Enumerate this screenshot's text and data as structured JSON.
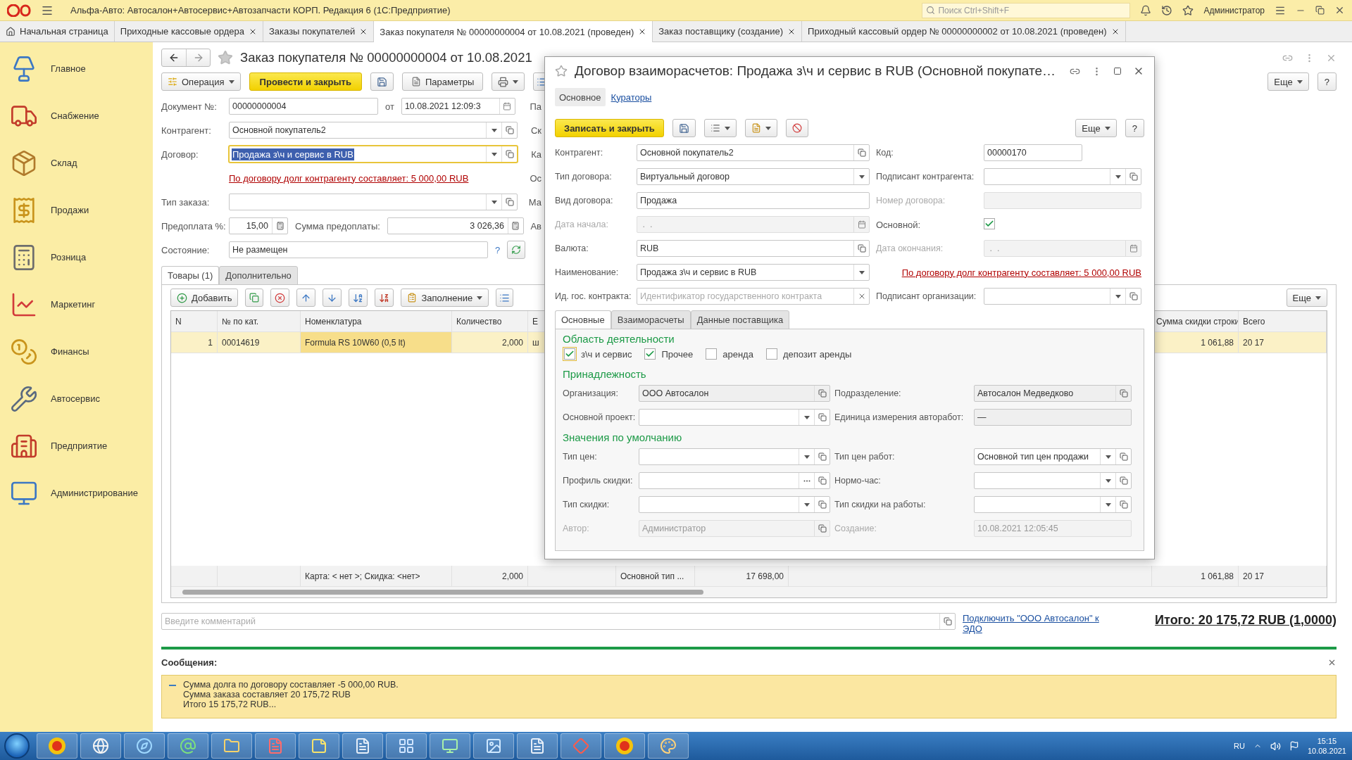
{
  "app_bar": {
    "title": "Альфа-Авто: Автосалон+Автосервис+Автозапчасти КОРП. Редакция 6  (1С:Предприятие)",
    "search_placeholder": "Поиск Ctrl+Shift+F",
    "user": "Администратор"
  },
  "tabs": [
    {
      "label": "Начальная страница",
      "selected": false,
      "kind": "home"
    },
    {
      "label": "Приходные кассовые ордера",
      "selected": false,
      "kind": "closable"
    },
    {
      "label": "Заказы покупателей",
      "selected": false,
      "kind": "closable"
    },
    {
      "label": "Заказ покупателя № 00000000004 от 10.08.2021 (проведен)",
      "selected": true,
      "kind": "closable"
    },
    {
      "label": "Заказ поставщику (создание)",
      "selected": false,
      "kind": "closable"
    },
    {
      "label": "Приходный кассовый ордер № 00000000002 от 10.08.2021 (проведен)",
      "selected": false,
      "kind": "closable"
    }
  ],
  "sidebar": {
    "items": [
      {
        "label": "Главное"
      },
      {
        "label": "Снабжение"
      },
      {
        "label": "Склад"
      },
      {
        "label": "Продажи"
      },
      {
        "label": "Розница"
      },
      {
        "label": "Маркетинг"
      },
      {
        "label": "Финансы"
      },
      {
        "label": "Автосервис"
      },
      {
        "label": "Предприятие"
      },
      {
        "label": "Администрирование"
      }
    ]
  },
  "document": {
    "title": "Заказ покупателя № 00000000004 от 10.08.2021",
    "toolbar": [
      {
        "kind": "menu",
        "label": "Операция"
      },
      {
        "kind": "primary",
        "label": "Провести и закрыть"
      },
      {
        "kind": "save"
      },
      {
        "kind": "doc",
        "label": "Параметры"
      },
      {
        "kind": "print"
      },
      {
        "kind": "list"
      }
    ],
    "more": "Еще",
    "help": "?",
    "number": {
      "label": "Документ №:",
      "value": "00000000004"
    },
    "date": {
      "label": "от",
      "value": "10.08.2021 12:09:3"
    },
    "counterparty": {
      "label": "Контрагент:",
      "value": "Основной покупатель2"
    },
    "contract": {
      "label": "Договор:",
      "value": "Продажа з\\ч и сервис в RUB",
      "focused": true
    },
    "debt_link": "По договору долг контрагенту составляет: 5 000,00 RUB",
    "order_type": {
      "label": "Тип заказа:"
    },
    "prepayment_percent": {
      "label": "Предоплата %:",
      "value": "15,00"
    },
    "prepayment_sum": {
      "label": "Сумма предоплаты:",
      "value": "3 026,36"
    },
    "status": {
      "label": "Состояние:",
      "value": "Не размещен",
      "help": "?"
    },
    "cut_labels": [
      "Па",
      "Ск",
      "Ка",
      "Ос",
      "Ма",
      "Ав"
    ],
    "subtabs": [
      {
        "label": "Товары (1)",
        "selected": true
      },
      {
        "label": "Дополнительно",
        "selected": false
      }
    ],
    "table_toolbar": [
      {
        "kind": "add",
        "label": "Добавить"
      },
      {
        "kind": "copy"
      },
      {
        "kind": "delete"
      },
      {
        "kind": "up"
      },
      {
        "kind": "down"
      },
      {
        "kind": "sort_asc"
      },
      {
        "kind": "sort_desc"
      },
      {
        "kind": "fill",
        "label": "Заполнение"
      },
      {
        "kind": "list"
      }
    ],
    "table_more": "Еще",
    "table": {
      "columns": {
        "column_1": "N",
        "column_2": "№ по кат.",
        "column_3": "Номенклатура",
        "column_4": "Количество",
        "column_5": "Е",
        "column_9": "Сумма скидки строки",
        "column_10": "Всего"
      },
      "rows": [
        {
          "column_1": {
            "text": "1",
            "selected": false
          },
          "column_2": {
            "text": "00014619",
            "selected": false
          },
          "column_3": {
            "text": "Formula RS 10W60 (0,5 lt)",
            "selected": true
          },
          "column_4": {
            "text": "2,000",
            "selected": false
          },
          "column_5": {
            "text": "ш",
            "selected": false
          },
          "column_9": {
            "text": "1 061,88",
            "selected": false
          },
          "column_10": {
            "text": "20 17",
            "selected": false
          }
        }
      ],
      "footer": {
        "column_3": "Карта: < нет >; Скидка: <нет>",
        "column_4": "2,000",
        "column_6": "Основной тип ...",
        "column_7": "17 698,00",
        "column_9": "1 061,88",
        "column_10": "20 17"
      }
    },
    "comment_placeholder": "Введите комментарий",
    "edo_link": "Подключить \"ООО Автосалон\" к ЭДО",
    "total": "Итого: 20 175,72 RUB (1,0000)"
  },
  "messages": {
    "title": "Сообщения:",
    "text": "Сумма долга по договору составляет -5 000,00 RUB.\nСумма заказа составляет 20 175,72 RUB\nИтого 15 175,72 RUB..."
  },
  "dialog": {
    "title": "Договор взаиморасчетов: Продажа з\\ч и сервис в RUB (Основной покупате…",
    "tabs": [
      {
        "label": "Основное",
        "selected": true
      },
      {
        "label": "Кураторы",
        "selected": false
      }
    ],
    "save_close": "Записать и закрыть",
    "more": "Еще",
    "help": "?",
    "rows": [
      {
        "left": {
          "kind": "field",
          "label": "Контрагент:",
          "value": "Основной покупатель2",
          "buttons": [
            {
              "kind": "open"
            }
          ]
        },
        "right": {
          "kind": "field",
          "label": "Код:",
          "value": "00000170",
          "short": true
        }
      },
      {
        "left": {
          "kind": "field",
          "label": "Тип договора:",
          "value": "Виртуальный договор",
          "buttons": [
            {
              "kind": "select"
            }
          ]
        },
        "right": {
          "kind": "field",
          "label": "Подписант контрагента:",
          "buttons": [
            {
              "kind": "select"
            },
            {
              "kind": "open"
            }
          ]
        }
      },
      {
        "left": {
          "kind": "field",
          "label": "Вид договора:",
          "value": "Продажа"
        },
        "right": {
          "kind": "field",
          "label": "Номер договора:",
          "disabled": true
        }
      },
      {
        "left": {
          "kind": "field",
          "label": "Дата начала:",
          "value": " .  .",
          "disabled": true,
          "buttons": [
            {
              "kind": "date"
            }
          ]
        },
        "right": {
          "kind": "checkbox",
          "label": "Основной:",
          "checked": true
        }
      },
      {
        "left": {
          "kind": "field",
          "label": "Валюта:",
          "value": "RUB",
          "buttons": [
            {
              "kind": "open"
            }
          ]
        },
        "right": {
          "kind": "field",
          "label": "Дата окончания:",
          "value": " .  .",
          "disabled": true,
          "buttons": [
            {
              "kind": "date"
            }
          ]
        }
      },
      {
        "left": {
          "kind": "field",
          "label": "Наименование:",
          "value": "Продажа з\\ч и сервис в RUB",
          "buttons": [
            {
              "kind": "select"
            }
          ]
        },
        "right": {
          "kind": "link",
          "text": "По договору долг контрагенту составляет: 5 000,00 RUB"
        }
      },
      {
        "left": {
          "kind": "field",
          "label": "Ид. гос. контракта:",
          "placeholder": "Идентификатор государственного контракта",
          "buttons": [
            {
              "kind": "clear"
            }
          ]
        },
        "right": {
          "kind": "field",
          "label": "Подписант организации:",
          "buttons": [
            {
              "kind": "select"
            },
            {
              "kind": "open"
            }
          ]
        }
      }
    ],
    "inner_tabs": [
      {
        "label": "Основные",
        "selected": true
      },
      {
        "label": "Взаиморасчеты",
        "selected": false
      },
      {
        "label": "Данные поставщика",
        "selected": false
      }
    ],
    "sections": [
      {
        "heading": "Область деятельности",
        "checkboxes": [
          {
            "label": "з\\ч и сервис",
            "checked": true,
            "focused": true
          },
          {
            "label": "Прочее",
            "checked": true,
            "focused": false
          },
          {
            "label": "аренда",
            "checked": false,
            "focused": false
          },
          {
            "label": "депозит аренды",
            "checked": false,
            "focused": false
          }
        ]
      },
      {
        "heading": "Принадлежность",
        "rows": [
          {
            "left": {
              "kind": "field",
              "label": "Организация:",
              "value": "ООО Автосалон",
              "readonly": true,
              "buttons": [
                {
                  "kind": "open"
                }
              ]
            },
            "right": {
              "kind": "field",
              "label": "Подразделение:",
              "value": "Автосалон Медведково",
              "readonly": true,
              "buttons": [
                {
                  "kind": "open"
                }
              ]
            }
          },
          {
            "left": {
              "kind": "field",
              "label": "Основной проект:",
              "buttons": [
                {
                  "kind": "select"
                },
                {
                  "kind": "open"
                }
              ]
            },
            "right": {
              "kind": "field",
              "label": "Единица измерения авторабот:",
              "value": "—",
              "readonly": true
            }
          }
        ]
      },
      {
        "heading": "Значения по умолчанию",
        "rows": [
          {
            "left": {
              "kind": "field",
              "label": "Тип цен:",
              "buttons": [
                {
                  "kind": "select"
                },
                {
                  "kind": "open"
                }
              ]
            },
            "right": {
              "kind": "field",
              "label": "Тип цен работ:",
              "value": "Основной тип цен продажи",
              "buttons": [
                {
                  "kind": "select"
                },
                {
                  "kind": "open"
                }
              ]
            }
          },
          {
            "left": {
              "kind": "field",
              "label": "Профиль скидки:",
              "buttons": [
                {
                  "kind": "more"
                },
                {
                  "kind": "open"
                }
              ]
            },
            "right": {
              "kind": "field",
              "label": "Нормо-час:",
              "buttons": [
                {
                  "kind": "select"
                },
                {
                  "kind": "open"
                }
              ]
            }
          },
          {
            "left": {
              "kind": "field",
              "label": "Тип скидки:",
              "buttons": [
                {
                  "kind": "select"
                },
                {
                  "kind": "open"
                }
              ]
            },
            "right": {
              "kind": "field",
              "label": "Тип скидки на работы:",
              "buttons": [
                {
                  "kind": "select"
                },
                {
                  "kind": "open"
                }
              ]
            }
          },
          {
            "left": {
              "kind": "field",
              "label": "Автор:",
              "value": "Администратор",
              "disabled": true,
              "buttons": [
                {
                  "kind": "open"
                }
              ]
            },
            "right": {
              "kind": "field",
              "label": "Создание:",
              "value": "10.08.2021 12:05:45",
              "disabled": true
            }
          }
        ]
      }
    ]
  },
  "taskbar": {
    "apps": [
      {
        "kind": "onec"
      },
      {
        "kind": "browser"
      },
      {
        "kind": "ie"
      },
      {
        "kind": "mail"
      },
      {
        "kind": "folder"
      },
      {
        "kind": "pdf"
      },
      {
        "kind": "notes"
      },
      {
        "kind": "doc"
      },
      {
        "kind": "panel"
      },
      {
        "kind": "monitor"
      },
      {
        "kind": "photo"
      },
      {
        "kind": "doc"
      },
      {
        "kind": "remote"
      },
      {
        "kind": "onec"
      },
      {
        "kind": "paint"
      }
    ],
    "language": "RU",
    "time": "15:15",
    "date": "10.08.2021"
  }
}
